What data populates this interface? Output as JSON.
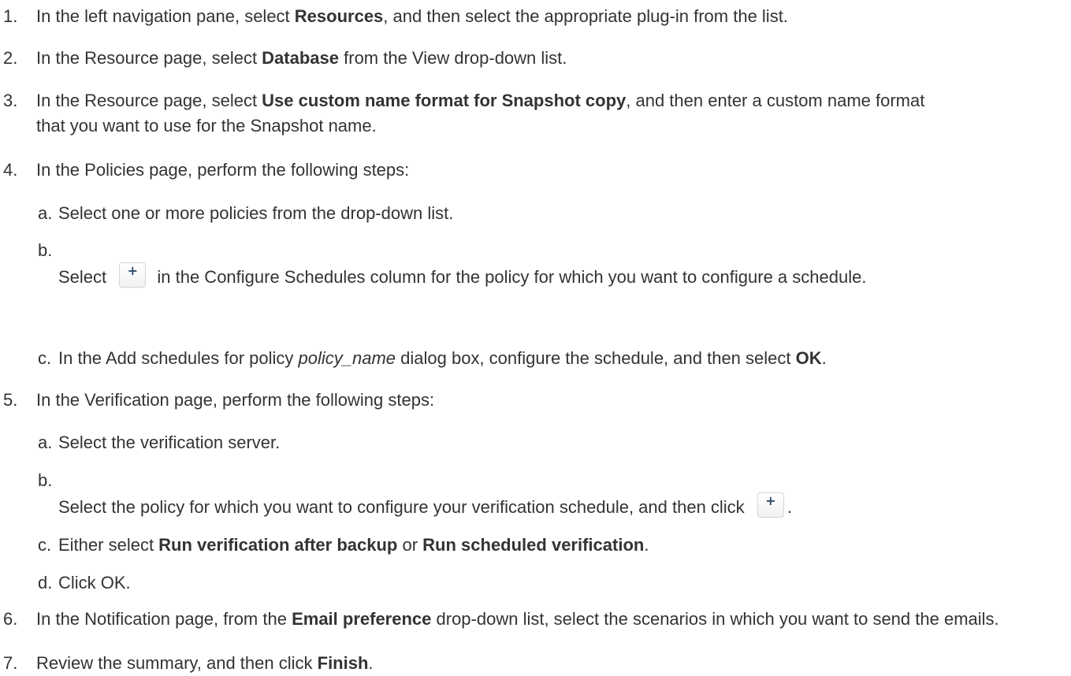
{
  "steps": [
    {
      "num": "1.",
      "pre": "In the left navigation pane, select ",
      "bold": "Resources",
      "post": ", and then select the appropriate plug-in from the list."
    },
    {
      "num": "2.",
      "pre": "In the Resource page, select ",
      "bold": "Database",
      "post": " from the View drop-down list."
    },
    {
      "num": "3.",
      "pre": "In the Resource page, select ",
      "bold": "Use custom name format for Snapshot copy",
      "post": ", and then enter a custom name format that you want to use for the Snapshot name."
    },
    {
      "num": "4.",
      "text": "In the Policies page, perform the following steps:",
      "substeps": [
        {
          "num": "a.",
          "text": "Select one or more policies from the drop-down list."
        },
        {
          "num": "b.",
          "pre": "Select ",
          "icon": "plus-icon",
          "post": " in the Configure Schedules column for the policy for which you want to configure a schedule."
        },
        {
          "num": "c.",
          "pre": "In the Add schedules for policy ",
          "italic": "policy_name",
          "mid": " dialog box, configure the schedule, and then select ",
          "bold": "OK",
          "post": "."
        }
      ]
    },
    {
      "num": "5.",
      "text": "In the Verification page, perform the following steps:",
      "substeps": [
        {
          "num": "a.",
          "text": "Select the verification server."
        },
        {
          "num": "b.",
          "pre": "Select the policy for which you want to configure your verification schedule, and then click ",
          "icon": "plus-icon",
          "post": "."
        },
        {
          "num": "c.",
          "pre": "Either select ",
          "bold1": "Run verification after backup",
          "mid": " or ",
          "bold2": "Run scheduled verification",
          "post": "."
        },
        {
          "num": "d.",
          "text": "Click OK."
        }
      ]
    },
    {
      "num": "6.",
      "pre": "In the Notification page, from the ",
      "bold": "Email preference",
      "post": " drop-down list, select the scenarios in which you want to send the emails."
    },
    {
      "num": "7.",
      "pre": "Review the summary, and then click ",
      "bold": "Finish",
      "post": "."
    }
  ],
  "icon_plus_glyph": "+"
}
